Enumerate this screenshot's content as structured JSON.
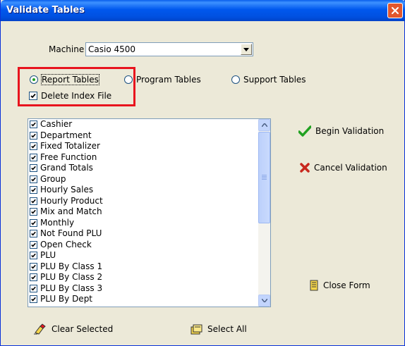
{
  "window": {
    "title": "Validate Tables"
  },
  "machine": {
    "label": "Machine",
    "value": "Casio 4500"
  },
  "table_types": [
    {
      "label": "Report Tables",
      "checked": true
    },
    {
      "label": "Program Tables",
      "checked": false
    },
    {
      "label": "Support Tables",
      "checked": false
    }
  ],
  "delete_index": {
    "label": "Delete Index File",
    "checked": true
  },
  "tables": [
    "Cashier",
    "Department",
    "Fixed Totalizer",
    "Free Function",
    "Grand Totals",
    "Group",
    "Hourly Sales",
    "Hourly Product",
    "Mix and Match",
    "Monthly",
    "Not Found PLU",
    "Open Check",
    "PLU",
    "PLU By Class 1",
    "PLU By Class 2",
    "PLU By Class 3",
    "PLU By Dept"
  ],
  "buttons": {
    "begin_validation": "Begin Validation",
    "cancel_validation": "Cancel Validation",
    "close_form": "Close Form",
    "clear_selected": "Clear Selected",
    "select_all": "Select All"
  },
  "icons": {
    "begin": "checkmark-icon",
    "cancel": "x-icon",
    "close": "document-icon",
    "clear": "eraser-icon",
    "select": "folders-icon"
  },
  "colors": {
    "title_bar": "#0058EE",
    "dialog_bg": "#ECE9D8",
    "highlight": "#E8141E",
    "check_green": "#21A121",
    "cancel_red": "#C8281E"
  }
}
